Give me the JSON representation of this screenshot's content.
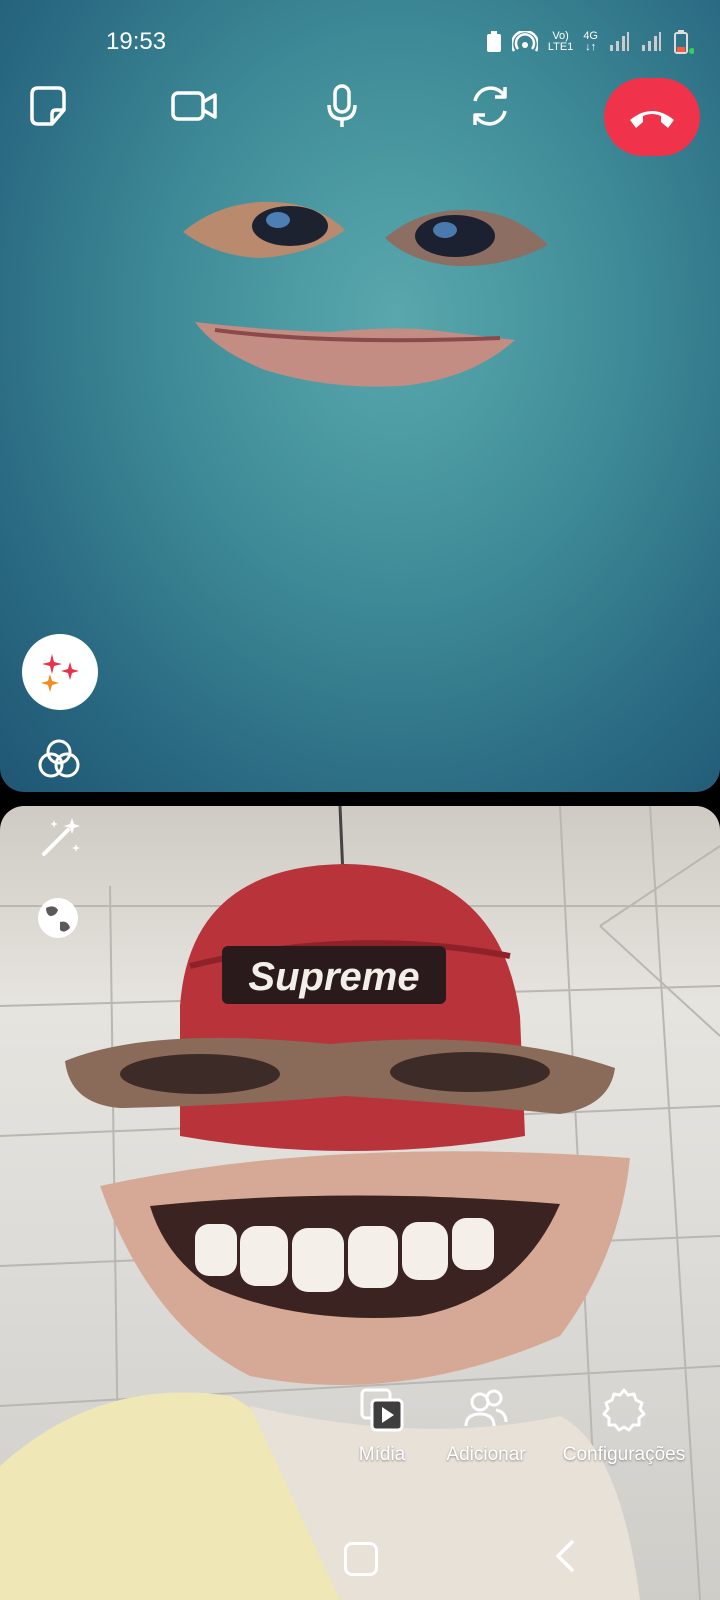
{
  "status_bar": {
    "time": "19:53",
    "network_line1": "Vo)",
    "network_line2": "LTE1",
    "network_type": "4G"
  },
  "call_controls": {
    "icons": [
      "sticker-icon",
      "video-camera-icon",
      "microphone-icon",
      "switch-camera-icon",
      "end-call-icon"
    ],
    "end_call_color": "#f0334a"
  },
  "remote_pane": {
    "background_colors": [
      "#5aa8ad",
      "#1f5674"
    ],
    "left_icons": [
      "sparkles-icon",
      "effects-rings-icon"
    ]
  },
  "local_pane": {
    "cap_text": "Supreme",
    "left_icons": [
      "magic-wand-icon",
      "globe-icon"
    ]
  },
  "actions": [
    {
      "label": "Mídia",
      "icon": "media-icon"
    },
    {
      "label": "Adicionar",
      "icon": "add-people-icon"
    },
    {
      "label": "Configurações",
      "icon": "settings-icon"
    }
  ],
  "nav": {
    "icons": [
      "home-icon",
      "back-icon"
    ]
  }
}
